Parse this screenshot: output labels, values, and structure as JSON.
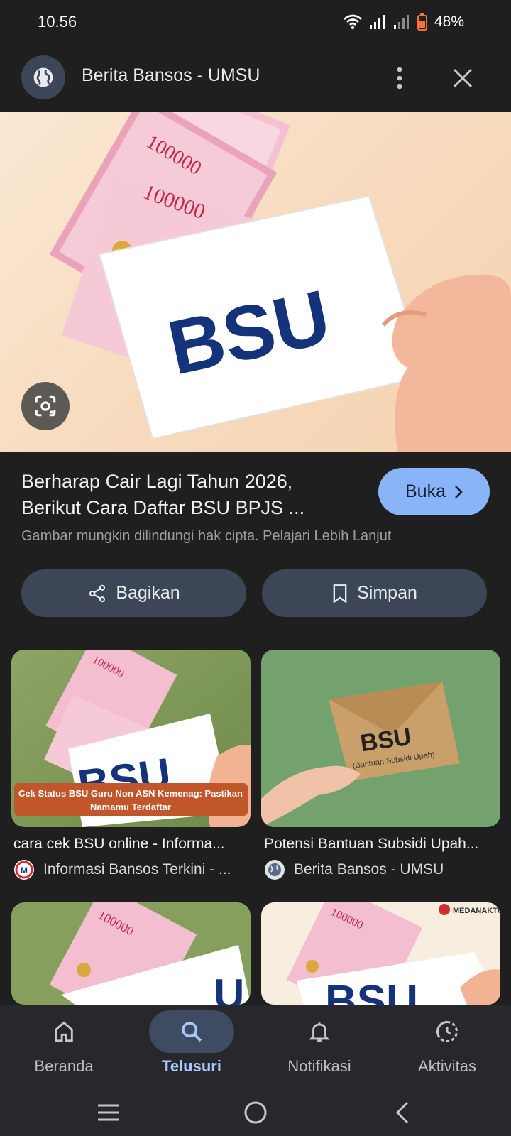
{
  "status_bar": {
    "time": "10.56",
    "battery": "48%"
  },
  "topbar": {
    "title": "Berita Bansos - UMSU"
  },
  "hero": {
    "envelope_text": "BSU",
    "banknote_text": "100000"
  },
  "result": {
    "title_line1": "Berharap Cair Lagi Tahun 2026,",
    "title_line2": "Berikut Cara Daftar BSU BPJS ...",
    "open_label": "Buka",
    "copyright_text": "Gambar mungkin dilindungi hak cipta. Pelajari Lebih Lanjut"
  },
  "actions": {
    "share_label": "Bagikan",
    "save_label": "Simpan"
  },
  "related": [
    {
      "title": "cara cek BSU online - Informa...",
      "source": "Informasi Bansos Terkini - ...",
      "img_text": "BSU",
      "banner_line1": "Cek Status BSU Guru Non ASN Kemenag: Pastikan",
      "banner_line2": "Namamu Terdaftar",
      "banknote_text": "100000"
    },
    {
      "title": "Potensi Bantuan Subsidi Upah...",
      "source": "Berita Bansos - UMSU",
      "img_text": "BSU",
      "img_subtext": "(Bantuan Subsidi Upah)"
    },
    {
      "banknote_text": "100000",
      "img_text": "U"
    },
    {
      "watermark": "MEDANAKTUA",
      "banknote_text": "100000",
      "img_text": "BSU"
    }
  ],
  "bottom_nav": [
    {
      "label": "Beranda",
      "icon": "home-icon",
      "active": false
    },
    {
      "label": "Telusuri",
      "icon": "search-icon",
      "active": true
    },
    {
      "label": "Notifikasi",
      "icon": "bell-icon",
      "active": false
    },
    {
      "label": "Aktivitas",
      "icon": "history-icon",
      "active": false
    }
  ],
  "colors": {
    "background": "#1f1f1f",
    "accent": "#8ab4f8",
    "active_nav": "#a8c7fa",
    "pill": "#3d4656",
    "bsu_blue": "#14337a"
  }
}
